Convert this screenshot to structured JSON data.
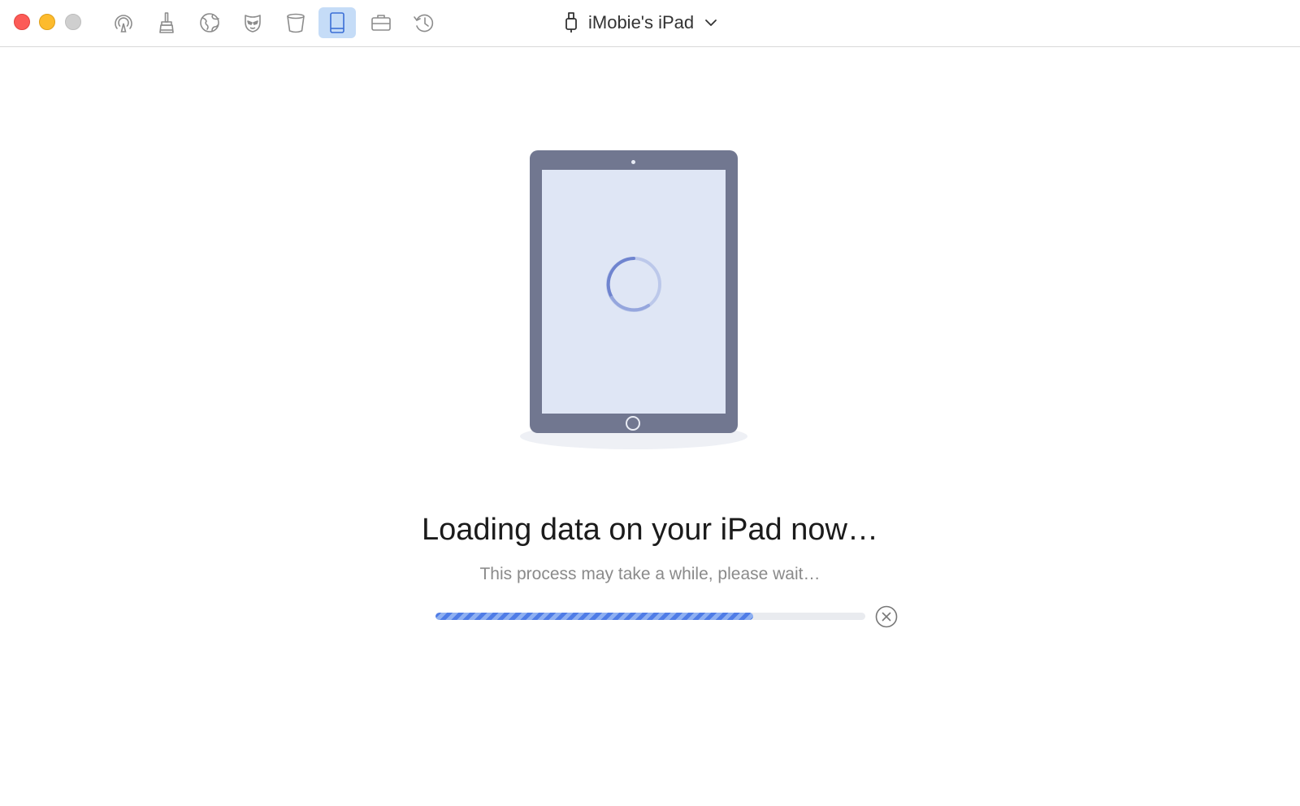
{
  "toolbar": {
    "tools": [
      {
        "icon": "airbackup-icon"
      },
      {
        "icon": "cleaner-icon"
      },
      {
        "icon": "internet-icon"
      },
      {
        "icon": "privacy-mask-icon"
      },
      {
        "icon": "trash-bin-icon"
      },
      {
        "icon": "ipad-device-icon",
        "active": true
      },
      {
        "icon": "toolkit-briefcase-icon"
      },
      {
        "icon": "history-icon"
      }
    ],
    "device_name": "iMobie's iPad",
    "device_icon": "usb-connector-icon",
    "dropdown_icon": "chevron-down-icon"
  },
  "loading": {
    "title": "Loading data on your iPad now…",
    "subtitle": "This process may take a while, please wait…",
    "progress": 0.74,
    "cancel_icon": "cancel-circle-icon"
  },
  "colors": {
    "accent": "#4f7ce6",
    "active_tool_bg": "#c5dcf7",
    "ipad_frame": "#717790",
    "ipad_screen": "#dfe6f5"
  }
}
